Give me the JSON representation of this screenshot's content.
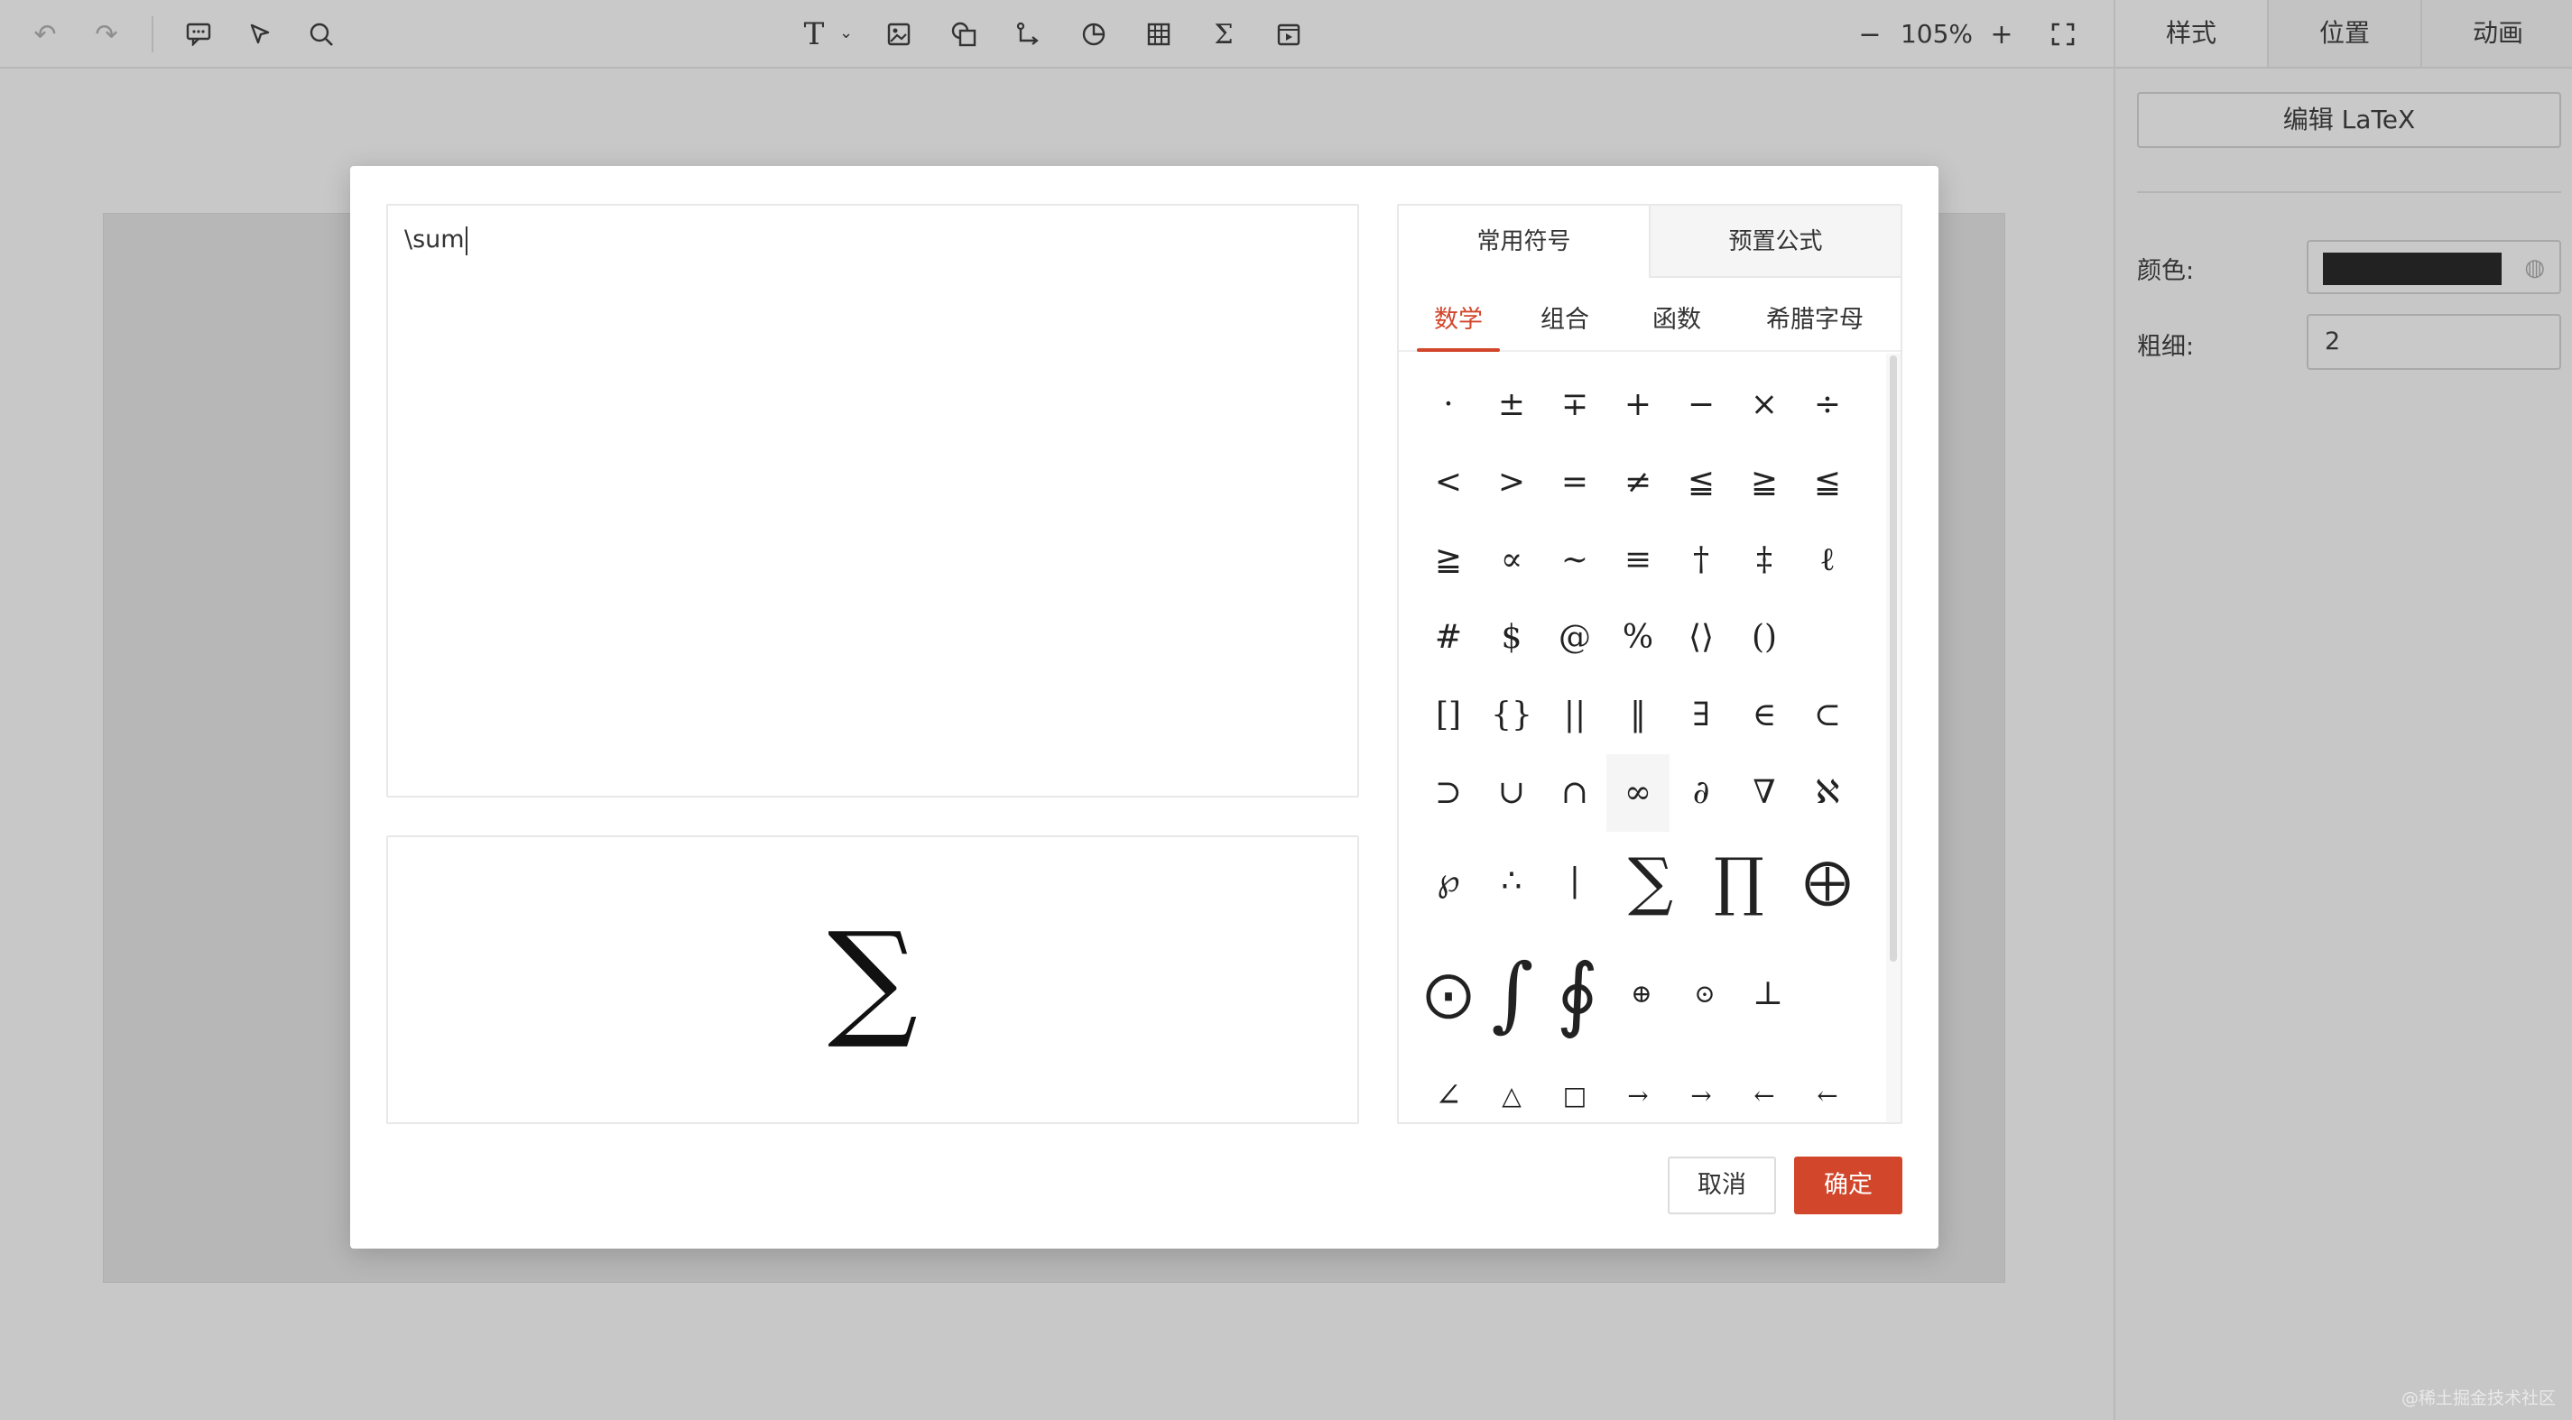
{
  "toolbar": {
    "undo_icon": "↶",
    "redo_icon": "↷",
    "comment_icon": "💬",
    "select_icon": "➤",
    "search_icon": "⌕",
    "text_icon": "T",
    "text_caret": "⌄",
    "image_icon": "▣",
    "shape_icon": "◰",
    "line_icon": "⤷",
    "chart_icon": "◔",
    "table_icon": "▦",
    "formula_icon": "Σ",
    "media_icon": "▤",
    "zoom_out": "−",
    "zoom_level": "105%",
    "zoom_in": "+",
    "fullscreen_icon": "⛶"
  },
  "right_panel": {
    "tabs": [
      "样式",
      "位置",
      "动画"
    ],
    "active_tab": "样式",
    "edit_latex_label": "编辑 LaTeX",
    "color_label": "颜色:",
    "color_value": "#222222",
    "palette_icon": "◍",
    "weight_label": "粗细:",
    "weight_value": "2"
  },
  "dialog": {
    "editor_text": "\\sum",
    "preview_symbol": "∑",
    "symbol_tabs": [
      "常用符号",
      "预置公式"
    ],
    "active_symbol_tab": "常用符号",
    "sub_tabs": [
      "数学",
      "组合",
      "函数",
      "希腊字母"
    ],
    "active_sub_tab": "数学",
    "symbol_rows": [
      [
        "·",
        "±",
        "∓",
        "+",
        "−",
        "×",
        "÷"
      ],
      [
        "<",
        ">",
        "=",
        "≠",
        "≦",
        "≧",
        "≦"
      ],
      [
        "≧",
        "∝",
        "∼",
        "≡",
        "†",
        "‡",
        "ℓ"
      ],
      [
        "#",
        "$",
        "@",
        "%",
        "⟨⟩",
        "()"
      ],
      [
        "[]",
        "{}",
        "||",
        "‖",
        "∃",
        "∈",
        "⊂"
      ],
      [
        "⊃",
        "∪",
        "∩",
        "∞",
        "∂",
        "∇",
        "ℵ"
      ],
      [
        "℘",
        "∴",
        "|",
        "∑",
        "∏",
        "⨁"
      ],
      [
        "⨀",
        "∫",
        "∮",
        "⊕",
        "⊙",
        "⊥"
      ],
      [
        "∠",
        "△",
        "□",
        "→",
        "→",
        "←",
        "←"
      ]
    ],
    "cancel_label": "取消",
    "ok_label": "确定"
  },
  "accent_color": "#d2462b",
  "watermark": "@稀土掘金技术社区"
}
